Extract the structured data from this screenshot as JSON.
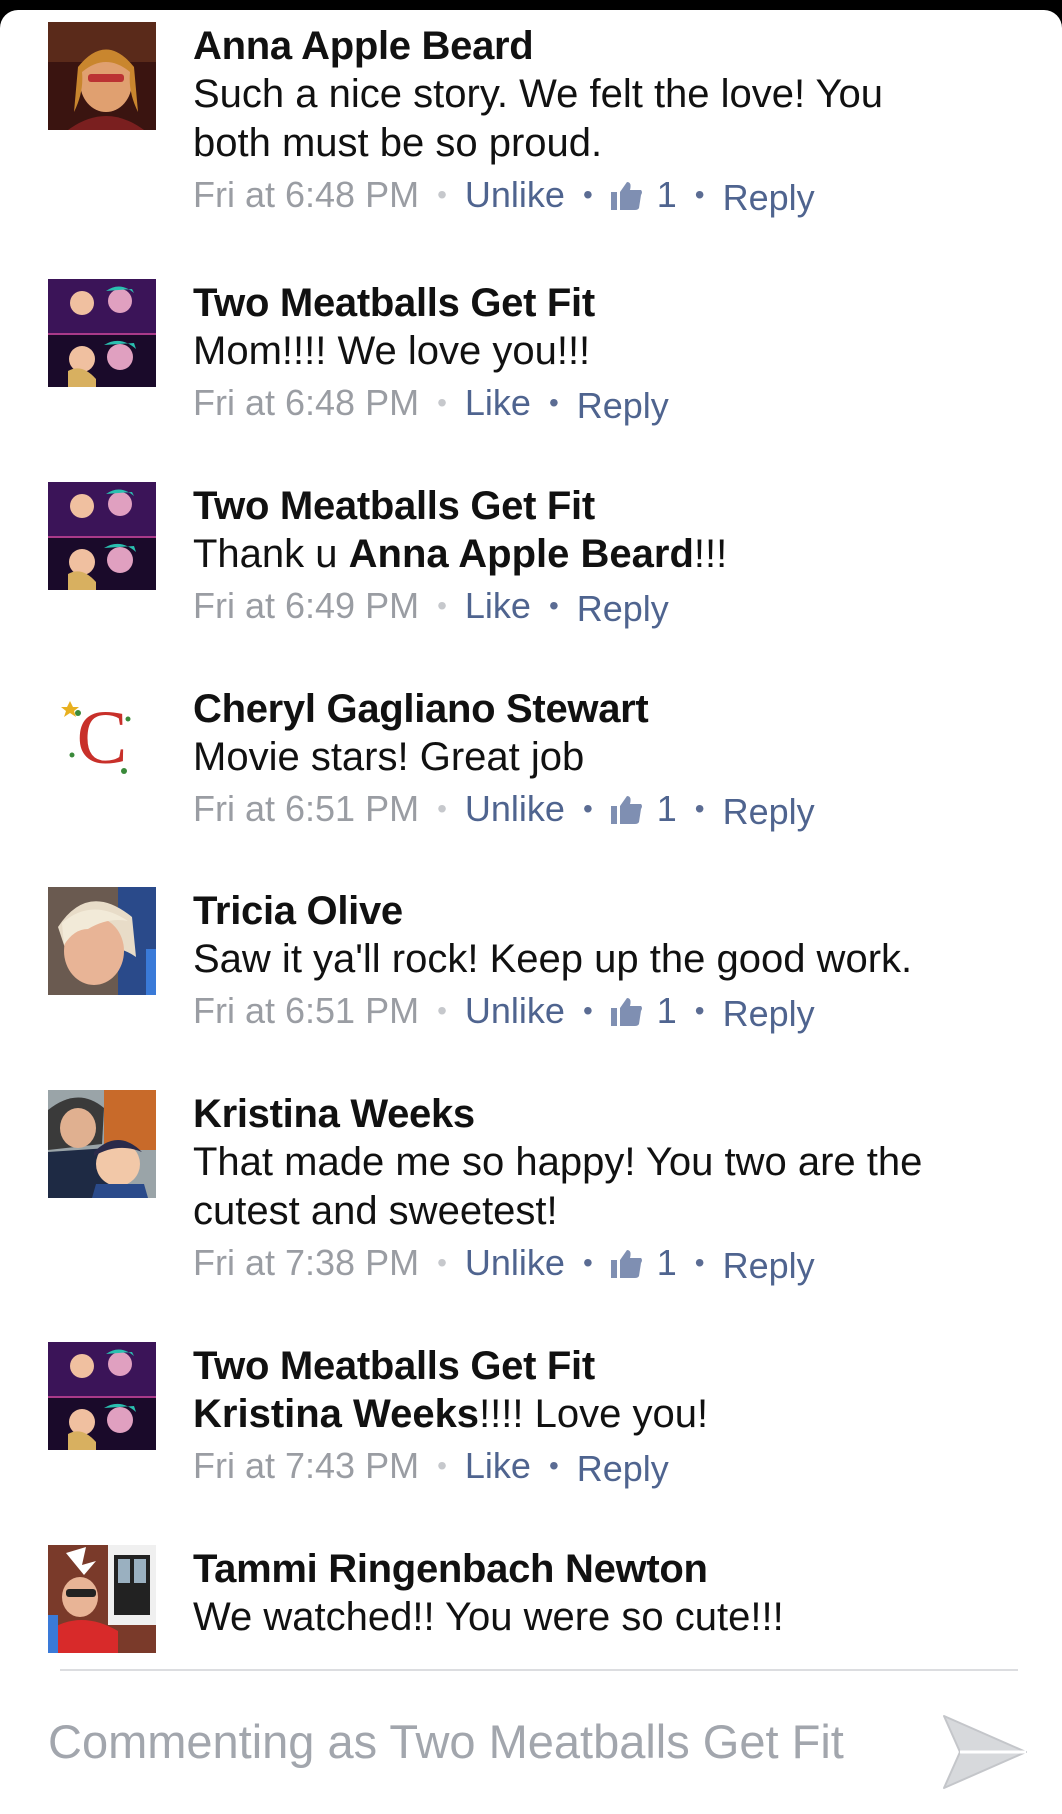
{
  "comments": [
    {
      "author": "Anna Apple Beard",
      "line1": "Such a nice story. We felt the love! You",
      "line2": "both must be so proud.",
      "time": "Fri at 6:48 PM",
      "action": "Unlike",
      "likes": "1",
      "reply": "Reply",
      "avatar": "avatar-anna"
    },
    {
      "author": "Two Meatballs Get Fit",
      "line1": "Mom!!!! We love you!!!",
      "time": "Fri at 6:48 PM",
      "action": "Like",
      "reply": "Reply",
      "avatar": "avatar-meatballs"
    },
    {
      "author": "Two Meatballs Get Fit",
      "text_prefix": "Thank u ",
      "mention": "Anna Apple Beard",
      "text_suffix": "!!!",
      "time": "Fri at 6:49 PM",
      "action": "Like",
      "reply": "Reply",
      "avatar": "avatar-meatballs"
    },
    {
      "author": "Cheryl Gagliano Stewart",
      "line1": "Movie stars! Great job",
      "time": "Fri at 6:51 PM",
      "action": "Unlike",
      "likes": "1",
      "reply": "Reply",
      "avatar": "avatar-cheryl"
    },
    {
      "author": "Tricia Olive",
      "line1": "Saw it ya'll rock! Keep up the good work.",
      "time": "Fri at 6:51 PM",
      "action": "Unlike",
      "likes": "1",
      "reply": "Reply",
      "avatar": "avatar-tricia"
    },
    {
      "author": "Kristina Weeks",
      "line1": "That made me so happy! You two are the",
      "line2": "cutest and sweetest!",
      "time": "Fri at 7:38 PM",
      "action": "Unlike",
      "likes": "1",
      "reply": "Reply",
      "avatar": "avatar-kristina"
    },
    {
      "author": "Two Meatballs Get Fit",
      "mention": "Kristina Weeks",
      "text_suffix": "!!!! Love you!",
      "time": "Fri at 7:43 PM",
      "action": "Like",
      "reply": "Reply",
      "avatar": "avatar-meatballs"
    },
    {
      "author": "Tammi Ringenbach Newton",
      "line1": "We watched!! You were so cute!!!",
      "avatar": "avatar-tammi"
    }
  ],
  "avatar_c_letter": "C",
  "composer": {
    "placeholder": "Commenting as Two Meatballs Get Fit",
    "send_icon": "send-icon"
  },
  "colors": {
    "link": "#4f648f",
    "meta": "#9a9da3"
  }
}
